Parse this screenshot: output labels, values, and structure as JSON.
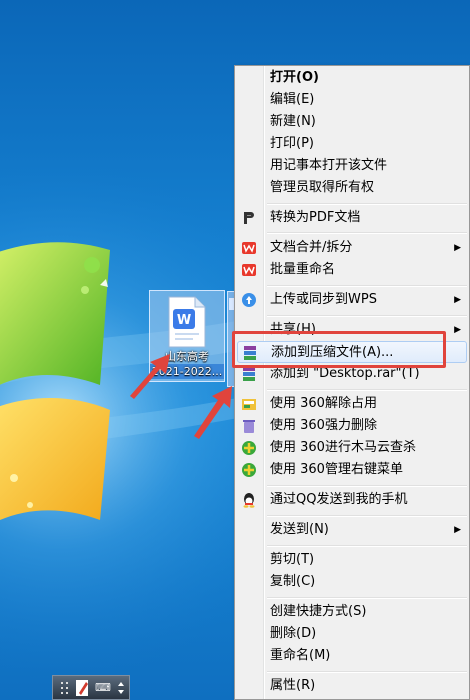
{
  "desktop": {
    "file": {
      "line1": "山东高考",
      "line2": "2021-2022..."
    }
  },
  "taskbar": {
    "text": "⌨"
  },
  "context_menu": {
    "items": [
      {
        "label": "打开(O)",
        "bold": true
      },
      {
        "label": "编辑(E)"
      },
      {
        "label": "新建(N)"
      },
      {
        "label": "打印(P)"
      },
      {
        "label": "用记事本打开该文件"
      },
      {
        "label": "管理员取得所有权"
      },
      {
        "label": "转换为PDF文档",
        "icon": "pdf-convert-icon"
      },
      {
        "label": "文档合并/拆分",
        "icon": "wps-icon",
        "submenu": true
      },
      {
        "label": "批量重命名",
        "icon": "wps-icon"
      },
      {
        "label": "上传或同步到WPS",
        "icon": "cloud-upload-icon",
        "submenu": true
      },
      {
        "label": "共享(H)",
        "submenu": true
      },
      {
        "label": "添加到压缩文件(A)...",
        "icon": "winrar-icon",
        "highlighted": true
      },
      {
        "label": "添加到 \"Desktop.rar\"(T)",
        "icon": "winrar-icon"
      },
      {
        "label": "使用 360解除占用",
        "icon": "360-unlock-icon"
      },
      {
        "label": "使用 360强力删除",
        "icon": "360-delete-icon"
      },
      {
        "label": "使用 360进行木马云查杀",
        "icon": "360-scan-icon"
      },
      {
        "label": "使用 360管理右键菜单",
        "icon": "360-menu-icon"
      },
      {
        "label": "通过QQ发送到我的手机",
        "icon": "qq-icon"
      },
      {
        "label": "发送到(N)",
        "submenu": true
      },
      {
        "label": "剪切(T)"
      },
      {
        "label": "复制(C)"
      },
      {
        "label": "创建快捷方式(S)"
      },
      {
        "label": "删除(D)"
      },
      {
        "label": "重命名(M)"
      },
      {
        "label": "属性(R)"
      }
    ],
    "submenu_arrow": "▶"
  },
  "colors": {
    "highlight_box": "#e0443c",
    "menu_bg": "#f0f0f0",
    "wps_red": "#e8382c"
  }
}
